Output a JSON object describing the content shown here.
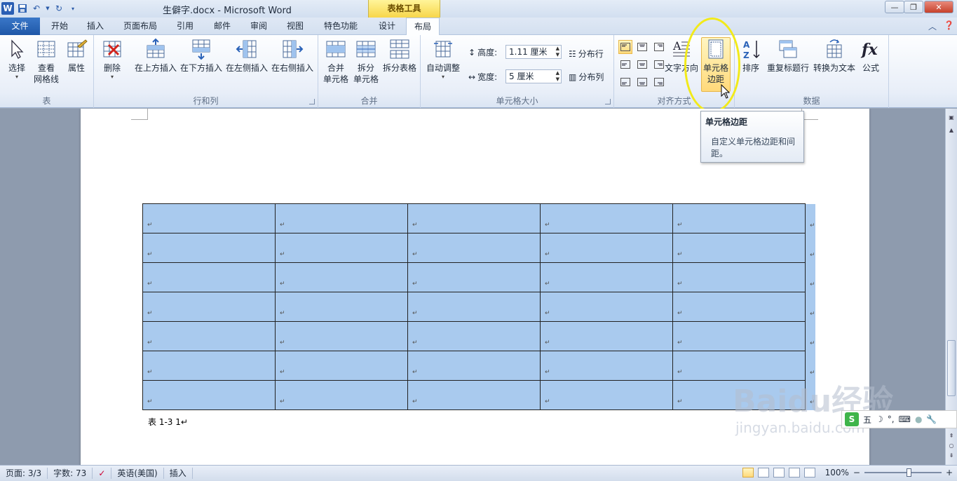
{
  "window": {
    "title": "生僻字.docx - Microsoft Word",
    "contextual_tab_group": "表格工具",
    "app_letter": "W"
  },
  "tabs": {
    "file": "文件",
    "items": [
      "开始",
      "插入",
      "页面布局",
      "引用",
      "邮件",
      "审阅",
      "视图",
      "特色功能",
      "设计",
      "布局"
    ],
    "active": "布局"
  },
  "ribbon": {
    "groups": {
      "table": {
        "label": "表",
        "buttons": [
          "选择",
          "查看\n网格线",
          "属性"
        ]
      },
      "rows_cols": {
        "label": "行和列",
        "buttons": [
          "删除",
          "在上方插入",
          "在下方插入",
          "在左侧插入",
          "在右侧插入"
        ]
      },
      "merge": {
        "label": "合并",
        "buttons": [
          "合并\n单元格",
          "拆分\n单元格",
          "拆分表格"
        ]
      },
      "cell_size": {
        "label": "单元格大小",
        "autofit": "自动调整",
        "height_label": "高度:",
        "height_value": "1.11 厘米",
        "width_label": "宽度:",
        "width_value": "5 厘米",
        "distribute_rows": "分布行",
        "distribute_cols": "分布列"
      },
      "alignment": {
        "label": "对齐方式",
        "text_direction": "文字方向",
        "cell_margins": "单元格\n边距"
      },
      "data": {
        "label": "数据",
        "buttons": [
          "排序",
          "重复标题行",
          "转换为文本",
          "公式"
        ]
      }
    }
  },
  "tooltip": {
    "title": "单元格边距",
    "body": "自定义单元格边距和间距。"
  },
  "document": {
    "caption": "表 1-3 1↵",
    "cell_mark": "↵",
    "rows": 7,
    "cols": 5
  },
  "ime": {
    "logo": "S",
    "mode": "五",
    "punct": "°,",
    "keyboard": "⌨"
  },
  "watermark": {
    "brand": "Baidu经验",
    "url": "jingyan.baidu.com"
  },
  "status": {
    "page": "页面: 3/3",
    "words": "字数: 73",
    "language": "英语(美国)",
    "mode": "插入",
    "zoom": "100%",
    "zoom_minus": "−",
    "zoom_plus": "+"
  },
  "colors": {
    "table_selection": "#a9caee",
    "file_tab": "#2b62b3",
    "contextual": "#f7d64a",
    "highlight_ring": "#f2ea1a"
  }
}
